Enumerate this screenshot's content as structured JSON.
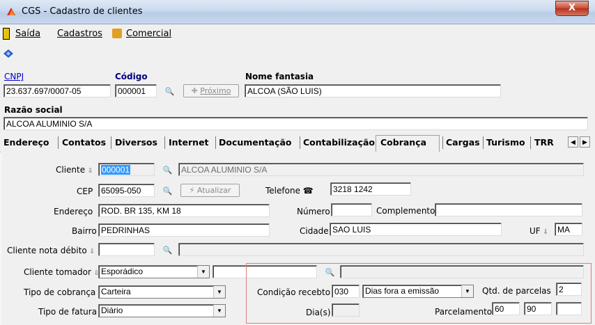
{
  "window": {
    "title": "CGS - Cadastro de clientes",
    "close_label": "X"
  },
  "menu": [
    {
      "label": "Saída"
    },
    {
      "label": "Cadastros"
    },
    {
      "label": "Comercial"
    }
  ],
  "header": {
    "cnpj_label": "CNPJ",
    "cnpj_value": "23.637.697/0007-05",
    "codigo_label": "Código",
    "codigo_value": "000001",
    "proximo_label": "Próximo",
    "nome_fantasia_label": "Nome fantasia",
    "nome_fantasia_value": "ALCOA (SÃO LUIS)",
    "razao_social_label": "Razão social",
    "razao_social_value": "ALCOA ALUMINIO S/A"
  },
  "tabs": [
    {
      "label": "Endereço"
    },
    {
      "label": "Contatos"
    },
    {
      "label": "Diversos"
    },
    {
      "label": "Internet"
    },
    {
      "label": "Documentação"
    },
    {
      "label": "Contabilização"
    },
    {
      "label": "Cobrança",
      "active": true
    },
    {
      "label": "Cargas"
    },
    {
      "label": "Turismo"
    },
    {
      "label": "TRR"
    }
  ],
  "cobranca": {
    "cliente_label": "Cliente",
    "cliente_code": "000001",
    "cliente_name": "ALCOA ALUMINIO S/A",
    "cep_label": "CEP",
    "cep_value": "65095-050",
    "atualizar_label": "Atualizar",
    "telefone_label": "Telefone",
    "telefone_value": "3218 1242",
    "endereco_label": "Endereço",
    "endereco_value": "ROD. BR 135, KM 18",
    "numero_label": "Número",
    "numero_value": "",
    "complemento_label": "Complemento",
    "complemento_value": "",
    "bairro_label": "Bairro",
    "bairro_value": "PEDRINHAS",
    "cidade_label": "Cidade",
    "cidade_value": "SAO LUIS",
    "uf_label": "UF",
    "uf_value": "MA",
    "cliente_nota_debito_label": "Cliente nota débito",
    "cliente_tomador_label": "Cliente tomador",
    "cliente_tomador_value": "Esporádico",
    "tipo_cobranca_label": "Tipo de cobrança",
    "tipo_cobranca_value": "Carteira",
    "tipo_fatura_label": "Tipo de fatura",
    "tipo_fatura_value": "Diário",
    "condicao_recebto_label": "Condição recebto",
    "condicao_recebto_value": "030",
    "condicao_tipo_value": "Dias fora a emissão",
    "qtd_parcelas_label": "Qtd. de parcelas",
    "qtd_parcelas_value": "2",
    "dias_label": "Dia(s)",
    "parcelamento_label": "Parcelamento",
    "parcelamento_values": [
      "60",
      "90",
      ""
    ]
  },
  "colors": {
    "highlight_border": "#e27c7c",
    "selection": "#3399ff",
    "link": "#0000cc",
    "code_label": "#000080"
  }
}
